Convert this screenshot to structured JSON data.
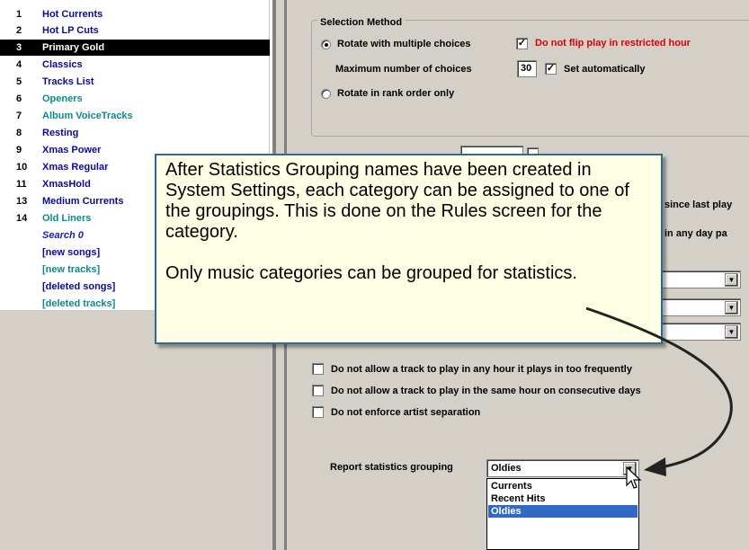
{
  "categories": [
    {
      "num": "1",
      "label": "Hot Currents",
      "style": "navy"
    },
    {
      "num": "2",
      "label": "Hot LP Cuts",
      "style": "navy"
    },
    {
      "num": "3",
      "label": "Primary Gold",
      "style": "selected"
    },
    {
      "num": "4",
      "label": "Classics",
      "style": "navy"
    },
    {
      "num": "5",
      "label": "Tracks List",
      "style": "navy"
    },
    {
      "num": "6",
      "label": "Openers",
      "style": "teal"
    },
    {
      "num": "7",
      "label": "Album VoiceTracks",
      "style": "teal"
    },
    {
      "num": "8",
      "label": "Resting",
      "style": "navy"
    },
    {
      "num": "9",
      "label": "Xmas Power",
      "style": "navy"
    },
    {
      "num": "10",
      "label": "Xmas Regular",
      "style": "navy"
    },
    {
      "num": "11",
      "label": "XmasHold",
      "style": "navy"
    },
    {
      "num": "13",
      "label": "Medium Currents",
      "style": "navy"
    },
    {
      "num": "14",
      "label": "Old Liners",
      "style": "teal"
    }
  ],
  "search_items": [
    {
      "label": "Search 0",
      "style": "search"
    },
    {
      "label": "[new songs]",
      "style": "navy"
    },
    {
      "label": "[new tracks]",
      "style": "teal"
    },
    {
      "label": "[deleted songs]",
      "style": "navy"
    },
    {
      "label": "[deleted tracks]",
      "style": "teal"
    }
  ],
  "selection_method": {
    "title": "Selection Method",
    "rotate_multiple": "Rotate with multiple choices",
    "rotate_multiple_selected": true,
    "no_flip_checked": true,
    "no_flip_label": "Do not flip play in restricted hour",
    "max_choices_label": "Maximum number of choices",
    "max_choices_value": "30",
    "set_auto_checked": true,
    "set_auto_label": "Set automatically",
    "rank_order": "Rotate in rank order only",
    "rank_order_selected": false
  },
  "partial_text": {
    "since_last_play": "since last play",
    "any_day_part": "in any day pa"
  },
  "rules": [
    {
      "label": "Do not allow a track to play in any hour it plays in too frequently",
      "checked": false
    },
    {
      "label": "Do not allow a track to play in the same hour on consecutive days",
      "checked": false
    },
    {
      "label": "Do not enforce artist separation",
      "checked": false
    }
  ],
  "report_grouping": {
    "label": "Report statistics grouping",
    "value": "Oldies",
    "options": [
      "Currents",
      "Recent Hits",
      "Oldies"
    ],
    "highlighted": "Oldies"
  },
  "callout": {
    "para1": "After Statistics Grouping names have been created in System Settings, each category can be assigned to one of the groupings.  This is done on the Rules screen for the category.",
    "para2": "Only music categories can be grouped for statistics."
  },
  "colors": {
    "navy": "#0a0a96",
    "teal": "#0a8a8a",
    "red": "#e00000",
    "highlight": "#316ac5",
    "callout_bg": "#ffffe6",
    "callout_border": "#2a6d8f"
  }
}
